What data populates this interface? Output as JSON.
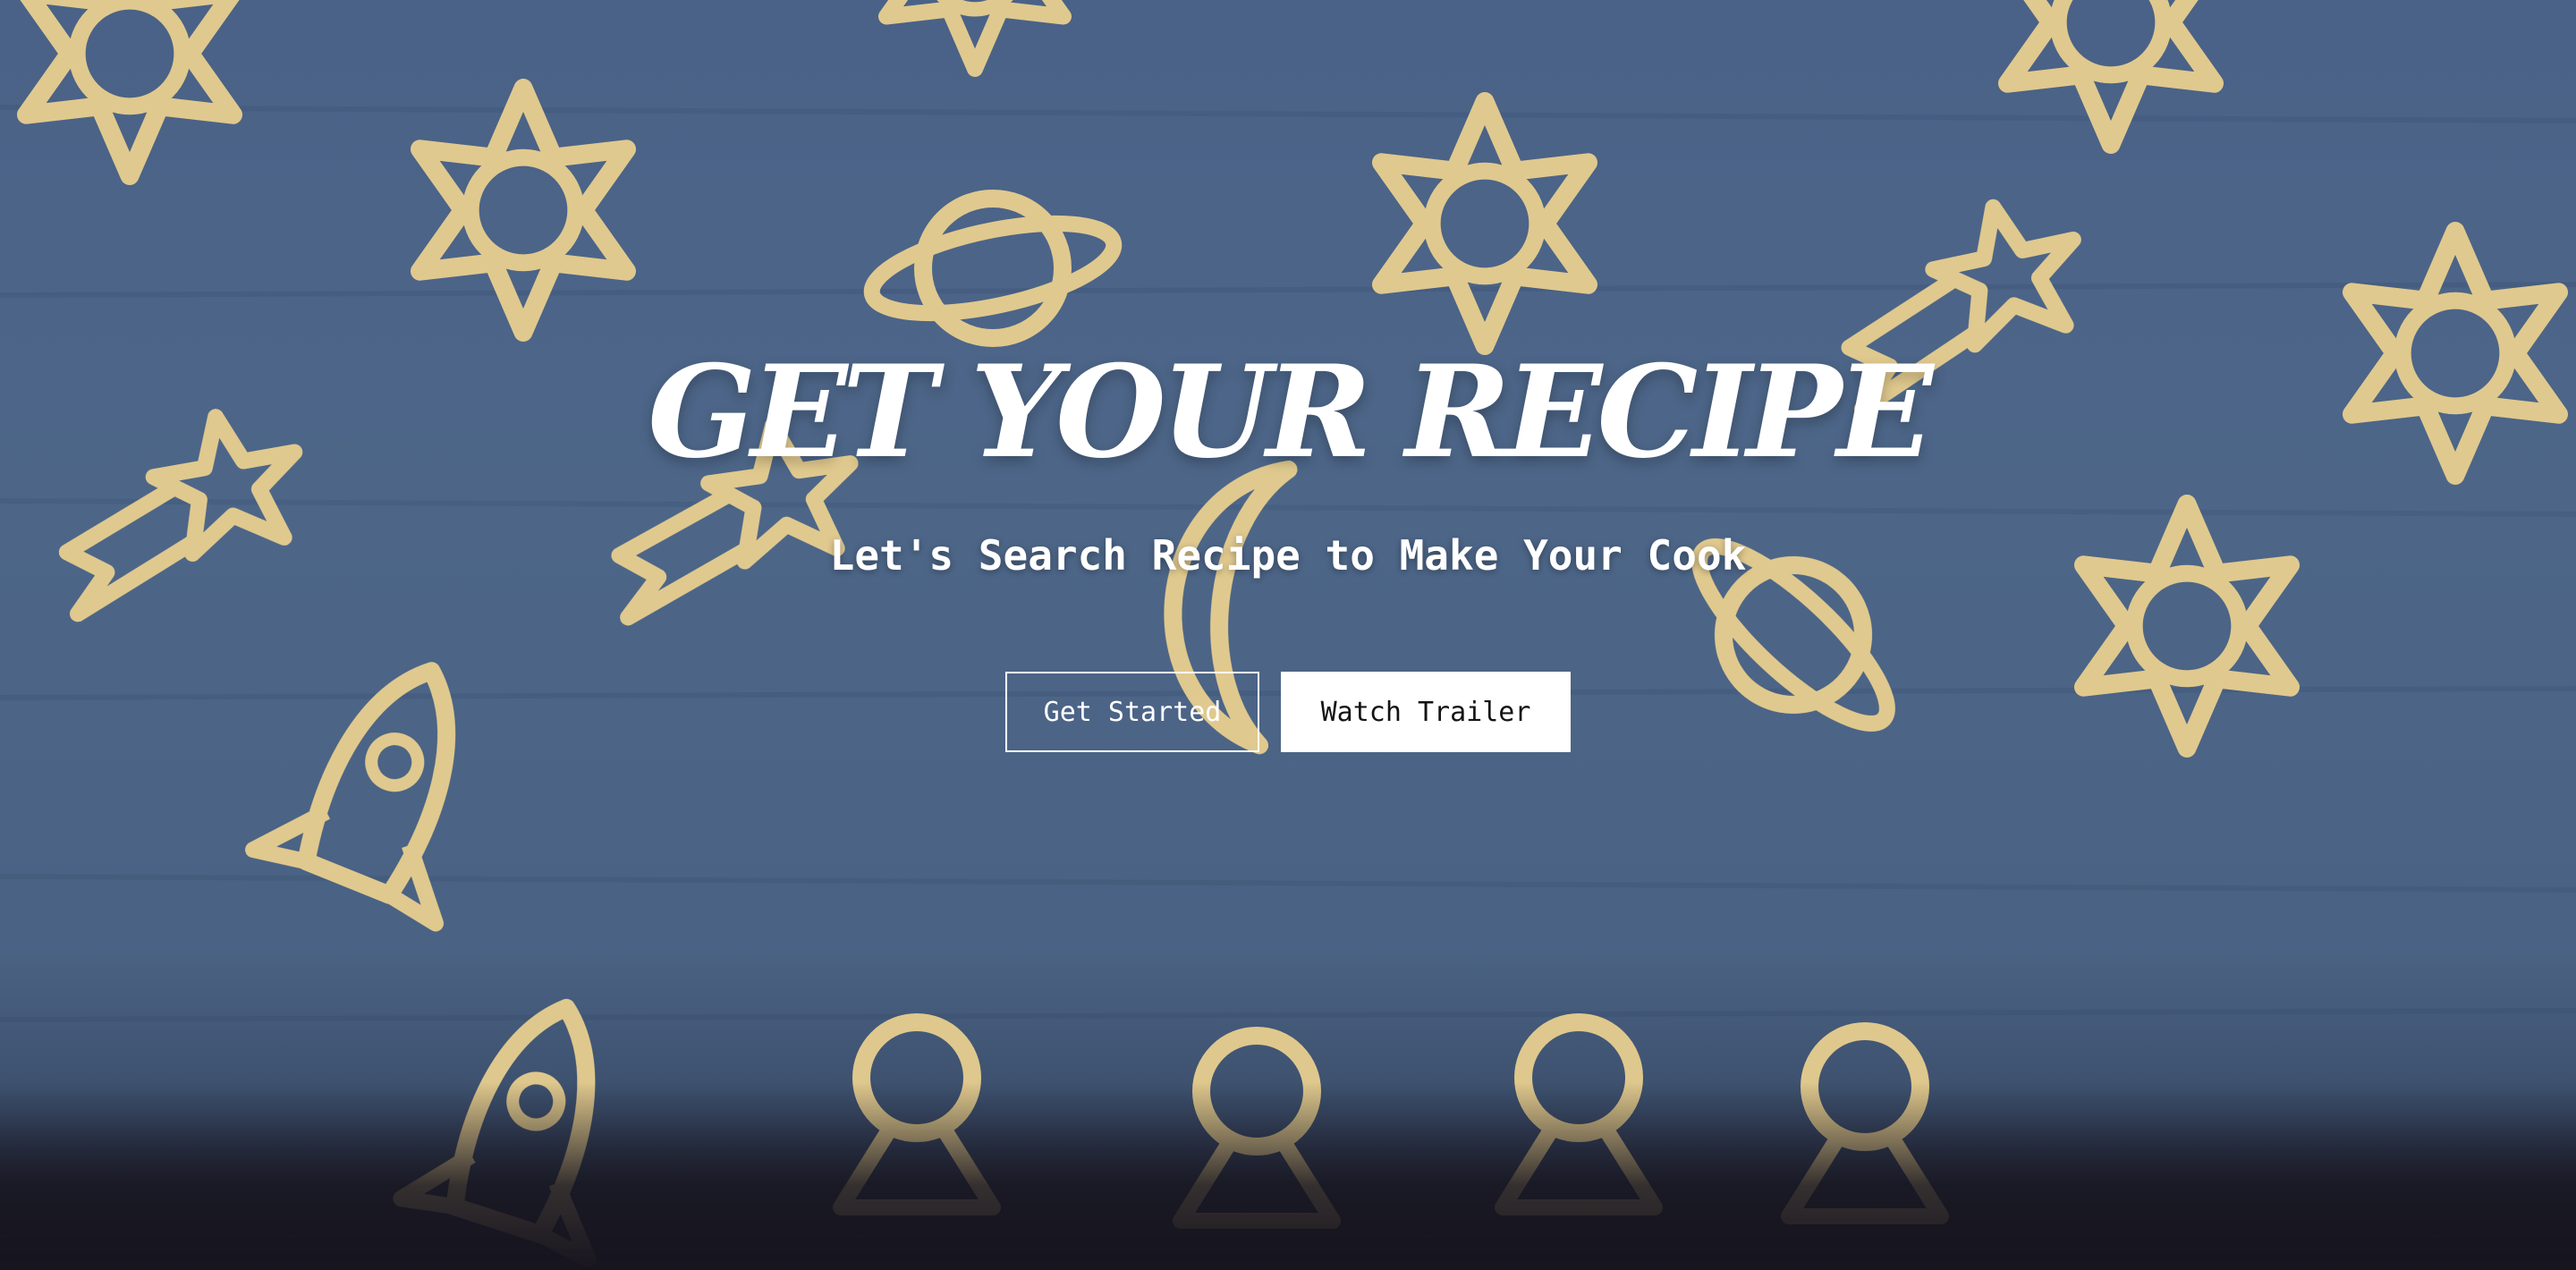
{
  "hero": {
    "title": "GET YOUR RECIPE",
    "subtitle": "Let's Search Recipe to Make Your Cook",
    "get_started_label": "Get Started",
    "watch_trailer_label": "Watch Trailer",
    "background_image": "blue wooden table with space-themed pasta shapes",
    "colors": {
      "table_blue": "#4b6386",
      "pasta": "#e8cf8f",
      "bottom_fade": "#17151f",
      "button_fill": "#ffffff"
    }
  }
}
